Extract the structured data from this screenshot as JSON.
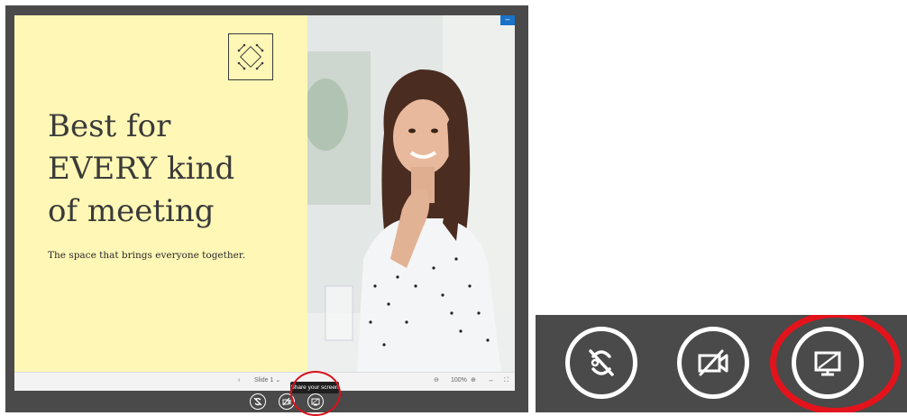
{
  "slide": {
    "headline_line1": "Best for",
    "headline_line2": "EVERY kind",
    "headline_line3": "of meeting",
    "tagline": "The space that brings everyone together."
  },
  "toolbar": {
    "prev_icon": "chevron-left-icon",
    "slide_selector": "Slide 1",
    "zoom_level": "100%",
    "zoom_out_icon": "zoom-out-icon",
    "zoom_in_icon": "zoom-in-icon",
    "fit_width_icon": "fit-width-icon",
    "fullscreen_icon": "fullscreen-icon"
  },
  "tooltip": {
    "text": "Share your screen"
  },
  "controls": [
    {
      "name": "mute-microphone-button",
      "icon": "muted-mic-icon"
    },
    {
      "name": "toggle-video-button",
      "icon": "video-off-icon"
    },
    {
      "name": "share-screen-button",
      "icon": "share-screen-icon"
    }
  ],
  "colors": {
    "slide_background": "#fff7b5",
    "meeting_background": "#4a4a4a",
    "highlight_ring": "#e3131c",
    "minimize_chip": "#1a73c9"
  }
}
